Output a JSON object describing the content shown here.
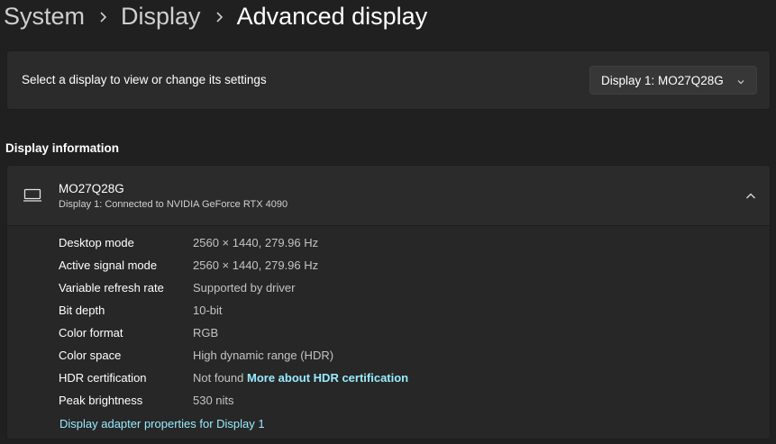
{
  "breadcrumb": {
    "items": [
      "System",
      "Display"
    ],
    "current": "Advanced display"
  },
  "display_select": {
    "label": "Select a display to view or change its settings",
    "selected": "Display 1: MO27Q28G"
  },
  "display_info": {
    "section_title": "Display information",
    "monitor_name": "MO27Q28G",
    "connection": "Display 1: Connected to NVIDIA GeForce RTX 4090",
    "rows": [
      {
        "label": "Desktop mode",
        "value": "2560 × 1440, 279.96 Hz"
      },
      {
        "label": "Active signal mode",
        "value": "2560 × 1440, 279.96 Hz"
      },
      {
        "label": "Variable refresh rate",
        "value": "Supported by driver"
      },
      {
        "label": "Bit depth",
        "value": "10-bit"
      },
      {
        "label": "Color format",
        "value": "RGB"
      },
      {
        "label": "Color space",
        "value": "High dynamic range (HDR)"
      },
      {
        "label": "HDR certification",
        "value": "Not found",
        "link": "More about HDR certification"
      },
      {
        "label": "Peak brightness",
        "value": "530 nits"
      }
    ],
    "adapter_link": "Display adapter properties for Display 1"
  },
  "colors": {
    "background": "#202020",
    "card": "#2b2b2b",
    "link": "#99ebff"
  }
}
